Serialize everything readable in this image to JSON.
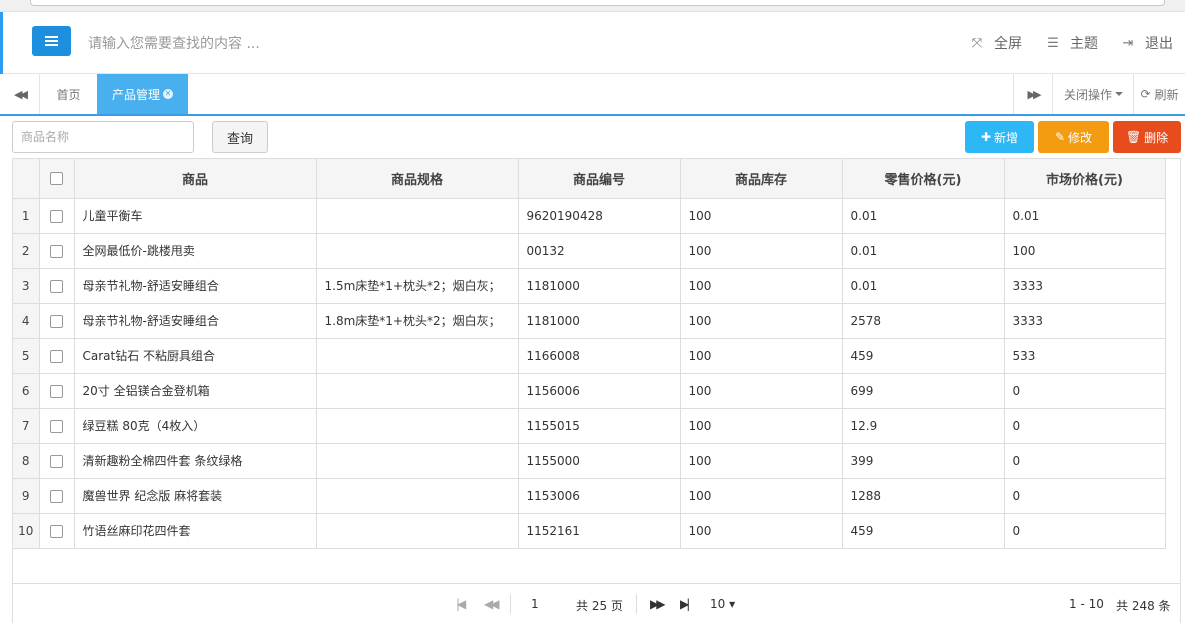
{
  "header": {
    "search_placeholder": "请输入您需要查找的内容 ...",
    "fullscreen_label": "全屏",
    "theme_label": "主题",
    "logout_label": "退出"
  },
  "tabs": {
    "home_label": "首页",
    "active_label": "产品管理",
    "close_ops_label": "关闭操作",
    "refresh_label": "刷新"
  },
  "toolbar": {
    "search_placeholder": "商品名称",
    "query_label": "查询",
    "add_label": "新增",
    "edit_label": "修改",
    "delete_label": "删除"
  },
  "table": {
    "columns": [
      "商品",
      "商品规格",
      "商品编号",
      "商品库存",
      "零售价格(元)",
      "市场价格(元)"
    ],
    "rows": [
      {
        "n": "1",
        "name": "儿童平衡车",
        "spec": "",
        "code": "9620190428",
        "stock": "100",
        "retail": "0.01",
        "market": "0.01"
      },
      {
        "n": "2",
        "name": "全网最低价-跳楼甩卖",
        "spec": "",
        "code": "00132",
        "stock": "100",
        "retail": "0.01",
        "market": "100"
      },
      {
        "n": "3",
        "name": "母亲节礼物-舒适安睡组合",
        "spec": "1.5m床垫*1+枕头*2；烟白灰；",
        "code": "1181000",
        "stock": "100",
        "retail": "0.01",
        "market": "3333"
      },
      {
        "n": "4",
        "name": "母亲节礼物-舒适安睡组合",
        "spec": "1.8m床垫*1+枕头*2；烟白灰；",
        "code": "1181000",
        "stock": "100",
        "retail": "2578",
        "market": "3333"
      },
      {
        "n": "5",
        "name": "Carat钻石 不粘厨具组合",
        "spec": "",
        "code": "1166008",
        "stock": "100",
        "retail": "459",
        "market": "533"
      },
      {
        "n": "6",
        "name": "20寸 全铝镁合金登机箱",
        "spec": "",
        "code": "1156006",
        "stock": "100",
        "retail": "699",
        "market": "0"
      },
      {
        "n": "7",
        "name": "绿豆糕 80克（4枚入）",
        "spec": "",
        "code": "1155015",
        "stock": "100",
        "retail": "12.9",
        "market": "0"
      },
      {
        "n": "8",
        "name": "清新趣粉全棉四件套 条纹绿格",
        "spec": "",
        "code": "1155000",
        "stock": "100",
        "retail": "399",
        "market": "0"
      },
      {
        "n": "9",
        "name": "魔兽世界 纪念版 麻将套装",
        "spec": "",
        "code": "1153006",
        "stock": "100",
        "retail": "1288",
        "market": "0"
      },
      {
        "n": "10",
        "name": "竹语丝麻印花四件套",
        "spec": "",
        "code": "1152161",
        "stock": "100",
        "retail": "459",
        "market": "0"
      }
    ]
  },
  "pager": {
    "current_page": "1",
    "total_pages_label": "共 25 页",
    "page_size": "10",
    "range_label": "1 - 10",
    "total_label": "共 248 条"
  }
}
